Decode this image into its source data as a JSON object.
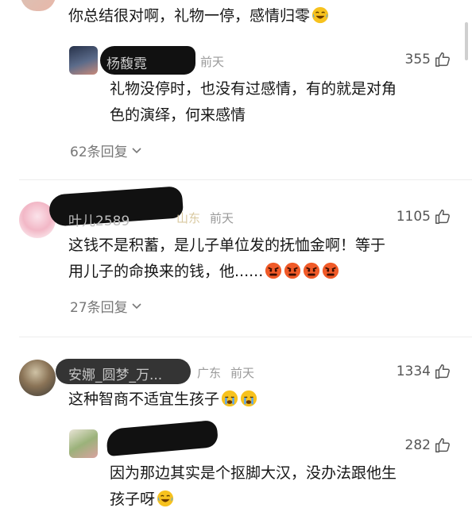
{
  "top_comment": {
    "text": "你总结很对啊，礼物一停，感情归零",
    "reply": {
      "author": "杨馥霓",
      "time": "前天",
      "likes": "355",
      "text_line1": "礼物没停时，也没有过感情，有的就是对角",
      "text_line2": "色的演绎，何来感情"
    },
    "replies_label": "62条回复"
  },
  "comment2": {
    "author": "叶儿2589",
    "location": "山东",
    "time": "前天",
    "likes": "1105",
    "text_line1": "这钱不是积蓄，是儿子单位发的抚恤金啊！等于",
    "text_line2": "用儿子的命换来的钱，他......",
    "replies_label": "27条回复"
  },
  "comment3": {
    "author": "安娜_圆梦_万...",
    "location": "广东",
    "time": "前天",
    "likes": "1334",
    "text": "这种智商不适宜生孩子",
    "reply": {
      "likes": "282",
      "text_line1": "因为那边其实是个抠脚大汉，没办法跟他生",
      "text_line2": "孩子呀"
    }
  },
  "icons": {
    "like": "thumbs-up-icon",
    "chevron": "chevron-down-icon",
    "laugh_emoji": "laugh-cry-emoji",
    "angry_emoji": "angry-emoji",
    "sob_emoji": "sob-emoji"
  }
}
